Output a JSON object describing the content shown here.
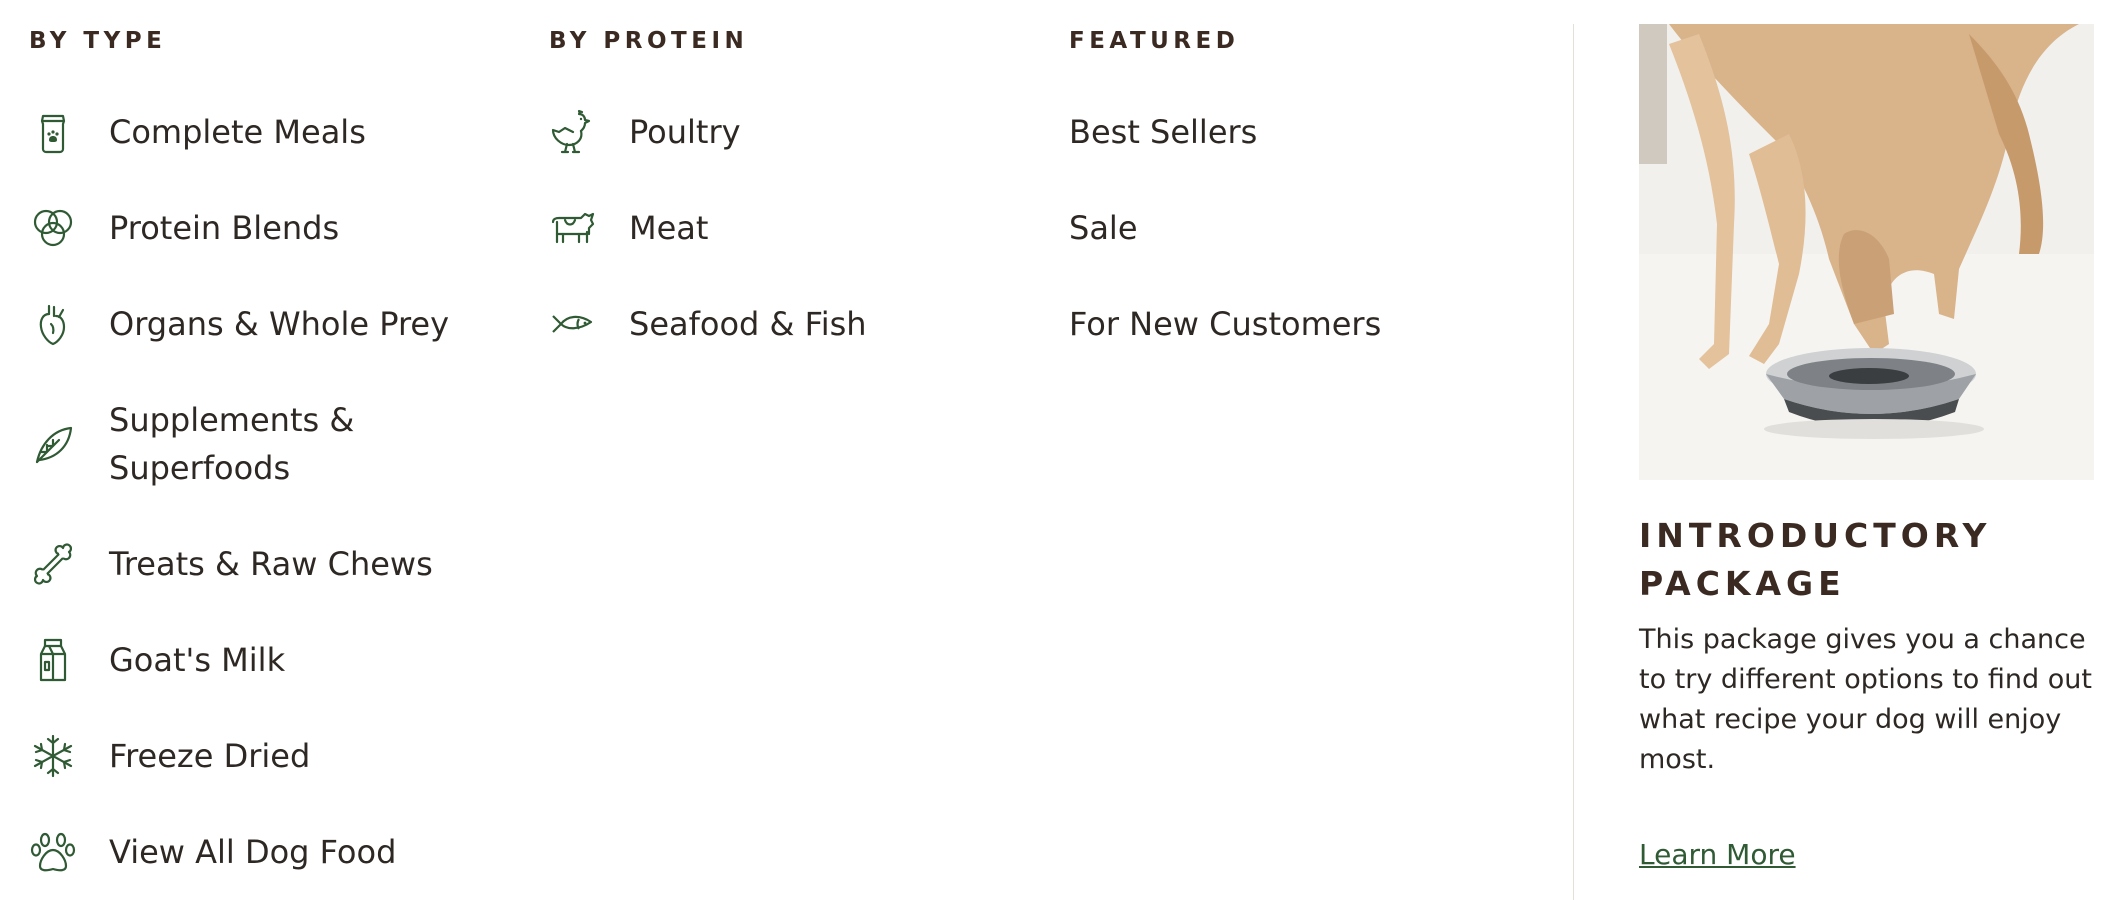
{
  "by_type": {
    "heading": "BY TYPE",
    "items": [
      {
        "label": "Complete Meals",
        "icon": "food-bag-icon"
      },
      {
        "label": "Protein Blends",
        "icon": "overlapping-circles-icon"
      },
      {
        "label": "Organs & Whole Prey",
        "icon": "heart-organ-icon"
      },
      {
        "label": "Supplements & Superfoods",
        "icon": "leaf-icon"
      },
      {
        "label": "Treats & Raw Chews",
        "icon": "bone-icon"
      },
      {
        "label": "Goat's Milk",
        "icon": "milk-carton-icon"
      },
      {
        "label": "Freeze Dried",
        "icon": "snowflake-icon"
      },
      {
        "label": "View All Dog Food",
        "icon": "paw-icon"
      }
    ]
  },
  "by_protein": {
    "heading": "BY PROTEIN",
    "items": [
      {
        "label": "Poultry",
        "icon": "chicken-icon"
      },
      {
        "label": "Meat",
        "icon": "cow-icon"
      },
      {
        "label": "Seafood & Fish",
        "icon": "fish-icon"
      }
    ]
  },
  "featured": {
    "heading": "FEATURED",
    "items": [
      {
        "label": "Best Sellers"
      },
      {
        "label": "Sale"
      },
      {
        "label": "For New Customers"
      }
    ]
  },
  "promo": {
    "image_alt": "Golden retriever eating from a steel bowl",
    "title": "INTRODUCTORY PACKAGE",
    "text": "This package gives you a chance to try different options to find out what recipe your dog will enjoy most.",
    "link": "Learn More"
  },
  "colors": {
    "icon_green": "#2f5a34",
    "heading": "#3a2a22",
    "text": "#2e2824",
    "divider": "#e3e0dc"
  }
}
